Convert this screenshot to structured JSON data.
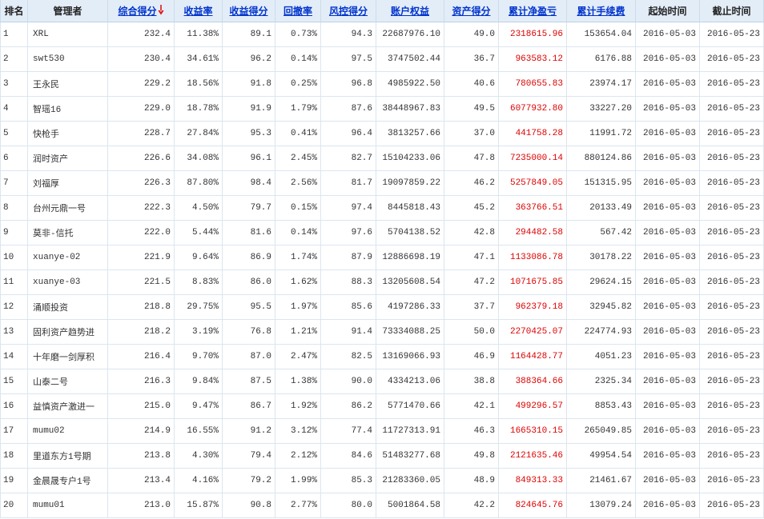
{
  "colors": {
    "header_link": "#0033cc",
    "net_pnl_text": "#dd0000",
    "sort_arrow": "#e01818",
    "header_bg": "#e3edf8",
    "grid_line": "#dbe5ef",
    "body_text": "#333333"
  },
  "table": {
    "columns": [
      {
        "label": "排名",
        "sortable": false
      },
      {
        "label": "管理者",
        "sortable": false
      },
      {
        "label": "综合得分",
        "sortable": true,
        "sort_icon": "sort-desc-arrow-icon"
      },
      {
        "label": "收益率",
        "sortable": true
      },
      {
        "label": "收益得分",
        "sortable": true
      },
      {
        "label": "回撤率",
        "sortable": true
      },
      {
        "label": "风控得分",
        "sortable": true
      },
      {
        "label": "账户权益",
        "sortable": true
      },
      {
        "label": "资产得分",
        "sortable": true
      },
      {
        "label": "累计净盈亏",
        "sortable": true
      },
      {
        "label": "累计手续费",
        "sortable": true
      },
      {
        "label": "起始时间",
        "sortable": false
      },
      {
        "label": "截止时间",
        "sortable": false
      }
    ],
    "rows": [
      {
        "rank": "1",
        "manager": "XRL",
        "composite_score": "232.4",
        "return_rate": "11.38%",
        "return_score": "89.1",
        "drawdown_rate": "0.73%",
        "risk_score": "94.3",
        "account_equity": "22687976.10",
        "asset_score": "49.0",
        "cumulative_net_pnl": "2318615.96",
        "cumulative_fees": "153654.04",
        "start_date": "2016-05-03",
        "end_date": "2016-05-23"
      },
      {
        "rank": "2",
        "manager": "swt530",
        "composite_score": "230.4",
        "return_rate": "34.61%",
        "return_score": "96.2",
        "drawdown_rate": "0.14%",
        "risk_score": "97.5",
        "account_equity": "3747502.44",
        "asset_score": "36.7",
        "cumulative_net_pnl": "963583.12",
        "cumulative_fees": "6176.88",
        "start_date": "2016-05-03",
        "end_date": "2016-05-23"
      },
      {
        "rank": "3",
        "manager": "王永民",
        "composite_score": "229.2",
        "return_rate": "18.56%",
        "return_score": "91.8",
        "drawdown_rate": "0.25%",
        "risk_score": "96.8",
        "account_equity": "4985922.50",
        "asset_score": "40.6",
        "cumulative_net_pnl": "780655.83",
        "cumulative_fees": "23974.17",
        "start_date": "2016-05-03",
        "end_date": "2016-05-23"
      },
      {
        "rank": "4",
        "manager": "智瑶16",
        "composite_score": "229.0",
        "return_rate": "18.78%",
        "return_score": "91.9",
        "drawdown_rate": "1.79%",
        "risk_score": "87.6",
        "account_equity": "38448967.83",
        "asset_score": "49.5",
        "cumulative_net_pnl": "6077932.80",
        "cumulative_fees": "33227.20",
        "start_date": "2016-05-03",
        "end_date": "2016-05-23"
      },
      {
        "rank": "5",
        "manager": "快枪手",
        "composite_score": "228.7",
        "return_rate": "27.84%",
        "return_score": "95.3",
        "drawdown_rate": "0.41%",
        "risk_score": "96.4",
        "account_equity": "3813257.66",
        "asset_score": "37.0",
        "cumulative_net_pnl": "441758.28",
        "cumulative_fees": "11991.72",
        "start_date": "2016-05-03",
        "end_date": "2016-05-23"
      },
      {
        "rank": "6",
        "manager": "润时资产",
        "composite_score": "226.6",
        "return_rate": "34.08%",
        "return_score": "96.1",
        "drawdown_rate": "2.45%",
        "risk_score": "82.7",
        "account_equity": "15104233.06",
        "asset_score": "47.8",
        "cumulative_net_pnl": "7235000.14",
        "cumulative_fees": "880124.86",
        "start_date": "2016-05-03",
        "end_date": "2016-05-23"
      },
      {
        "rank": "7",
        "manager": "刘福厚",
        "composite_score": "226.3",
        "return_rate": "87.80%",
        "return_score": "98.4",
        "drawdown_rate": "2.56%",
        "risk_score": "81.7",
        "account_equity": "19097859.22",
        "asset_score": "46.2",
        "cumulative_net_pnl": "5257849.05",
        "cumulative_fees": "151315.95",
        "start_date": "2016-05-03",
        "end_date": "2016-05-23"
      },
      {
        "rank": "8",
        "manager": "台州元鼎一号",
        "composite_score": "222.3",
        "return_rate": "4.50%",
        "return_score": "79.7",
        "drawdown_rate": "0.15%",
        "risk_score": "97.4",
        "account_equity": "8445818.43",
        "asset_score": "45.2",
        "cumulative_net_pnl": "363766.51",
        "cumulative_fees": "20133.49",
        "start_date": "2016-05-03",
        "end_date": "2016-05-23"
      },
      {
        "rank": "9",
        "manager": "莫非-信托",
        "composite_score": "222.0",
        "return_rate": "5.44%",
        "return_score": "81.6",
        "drawdown_rate": "0.14%",
        "risk_score": "97.6",
        "account_equity": "5704138.52",
        "asset_score": "42.8",
        "cumulative_net_pnl": "294482.58",
        "cumulative_fees": "567.42",
        "start_date": "2016-05-03",
        "end_date": "2016-05-23"
      },
      {
        "rank": "10",
        "manager": "xuanye-02",
        "composite_score": "221.9",
        "return_rate": "9.64%",
        "return_score": "86.9",
        "drawdown_rate": "1.74%",
        "risk_score": "87.9",
        "account_equity": "12886698.19",
        "asset_score": "47.1",
        "cumulative_net_pnl": "1133086.78",
        "cumulative_fees": "30178.22",
        "start_date": "2016-05-03",
        "end_date": "2016-05-23"
      },
      {
        "rank": "11",
        "manager": "xuanye-03",
        "composite_score": "221.5",
        "return_rate": "8.83%",
        "return_score": "86.0",
        "drawdown_rate": "1.62%",
        "risk_score": "88.3",
        "account_equity": "13205608.54",
        "asset_score": "47.2",
        "cumulative_net_pnl": "1071675.85",
        "cumulative_fees": "29624.15",
        "start_date": "2016-05-03",
        "end_date": "2016-05-23"
      },
      {
        "rank": "12",
        "manager": "涌顺投资",
        "composite_score": "218.8",
        "return_rate": "29.75%",
        "return_score": "95.5",
        "drawdown_rate": "1.97%",
        "risk_score": "85.6",
        "account_equity": "4197286.33",
        "asset_score": "37.7",
        "cumulative_net_pnl": "962379.18",
        "cumulative_fees": "32945.82",
        "start_date": "2016-05-03",
        "end_date": "2016-05-23"
      },
      {
        "rank": "13",
        "manager": "固利资产趋势进",
        "composite_score": "218.2",
        "return_rate": "3.19%",
        "return_score": "76.8",
        "drawdown_rate": "1.21%",
        "risk_score": "91.4",
        "account_equity": "73334088.25",
        "asset_score": "50.0",
        "cumulative_net_pnl": "2270425.07",
        "cumulative_fees": "224774.93",
        "start_date": "2016-05-03",
        "end_date": "2016-05-23"
      },
      {
        "rank": "14",
        "manager": "十年磨一剑厚积",
        "composite_score": "216.4",
        "return_rate": "9.70%",
        "return_score": "87.0",
        "drawdown_rate": "2.47%",
        "risk_score": "82.5",
        "account_equity": "13169066.93",
        "asset_score": "46.9",
        "cumulative_net_pnl": "1164428.77",
        "cumulative_fees": "4051.23",
        "start_date": "2016-05-03",
        "end_date": "2016-05-23"
      },
      {
        "rank": "15",
        "manager": "山泰二号",
        "composite_score": "216.3",
        "return_rate": "9.84%",
        "return_score": "87.5",
        "drawdown_rate": "1.38%",
        "risk_score": "90.0",
        "account_equity": "4334213.06",
        "asset_score": "38.8",
        "cumulative_net_pnl": "388364.66",
        "cumulative_fees": "2325.34",
        "start_date": "2016-05-03",
        "end_date": "2016-05-23"
      },
      {
        "rank": "16",
        "manager": "益慎资产激进一",
        "composite_score": "215.0",
        "return_rate": "9.47%",
        "return_score": "86.7",
        "drawdown_rate": "1.92%",
        "risk_score": "86.2",
        "account_equity": "5771470.66",
        "asset_score": "42.1",
        "cumulative_net_pnl": "499296.57",
        "cumulative_fees": "8853.43",
        "start_date": "2016-05-03",
        "end_date": "2016-05-23"
      },
      {
        "rank": "17",
        "manager": "mumu02",
        "composite_score": "214.9",
        "return_rate": "16.55%",
        "return_score": "91.2",
        "drawdown_rate": "3.12%",
        "risk_score": "77.4",
        "account_equity": "11727313.91",
        "asset_score": "46.3",
        "cumulative_net_pnl": "1665310.15",
        "cumulative_fees": "265049.85",
        "start_date": "2016-05-03",
        "end_date": "2016-05-23"
      },
      {
        "rank": "18",
        "manager": "里道东方1号期",
        "composite_score": "213.8",
        "return_rate": "4.30%",
        "return_score": "79.4",
        "drawdown_rate": "2.12%",
        "risk_score": "84.6",
        "account_equity": "51483277.68",
        "asset_score": "49.8",
        "cumulative_net_pnl": "2121635.46",
        "cumulative_fees": "49954.54",
        "start_date": "2016-05-03",
        "end_date": "2016-05-23"
      },
      {
        "rank": "19",
        "manager": "金晨晟专户1号",
        "composite_score": "213.4",
        "return_rate": "4.16%",
        "return_score": "79.2",
        "drawdown_rate": "1.99%",
        "risk_score": "85.3",
        "account_equity": "21283360.05",
        "asset_score": "48.9",
        "cumulative_net_pnl": "849313.33",
        "cumulative_fees": "21461.67",
        "start_date": "2016-05-03",
        "end_date": "2016-05-23"
      },
      {
        "rank": "20",
        "manager": "mumu01",
        "composite_score": "213.0",
        "return_rate": "15.87%",
        "return_score": "90.8",
        "drawdown_rate": "2.77%",
        "risk_score": "80.0",
        "account_equity": "5001864.58",
        "asset_score": "42.2",
        "cumulative_net_pnl": "824645.76",
        "cumulative_fees": "13079.24",
        "start_date": "2016-05-03",
        "end_date": "2016-05-23"
      }
    ]
  }
}
